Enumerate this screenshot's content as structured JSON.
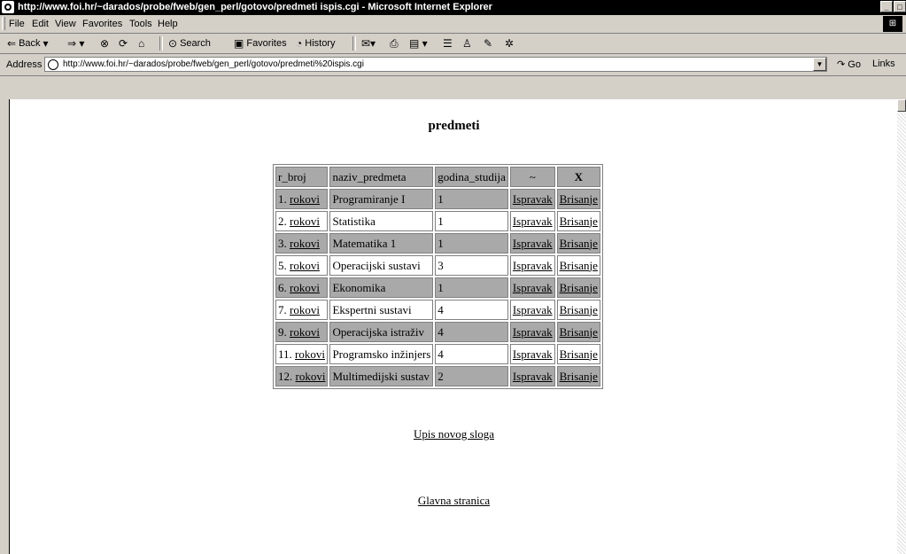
{
  "window": {
    "title": "http://www.foi.hr/~darados/probe/fweb/gen_perl/gotovo/predmeti ispis.cgi - Microsoft Internet Explorer"
  },
  "menu": [
    "File",
    "Edit",
    "View",
    "Favorites",
    "Tools",
    "Help"
  ],
  "toolbar": {
    "back": "Back",
    "search": "Search",
    "favorites": "Favorites",
    "history": "History"
  },
  "address": {
    "label": "Address",
    "url": "http://www.foi.hr/~darados/probe/fweb/gen_perl/gotovo/predmeti%20ispis.cgi",
    "go": "Go",
    "links": "Links"
  },
  "page": {
    "heading": "predmeti",
    "columns": [
      "r_broj",
      "naziv_predmeta",
      "godina_studija",
      "~",
      "X"
    ],
    "rows": [
      {
        "num": "1.",
        "link": "rokovi",
        "naziv": "Programiranje I",
        "godina": "1",
        "edit": "Ispravak",
        "delete": "Brisanje"
      },
      {
        "num": "2.",
        "link": "rokovi",
        "naziv": "Statistika",
        "godina": "1",
        "edit": "Ispravak",
        "delete": "Brisanje"
      },
      {
        "num": "3.",
        "link": "rokovi",
        "naziv": "Matematika 1",
        "godina": "1",
        "edit": "Ispravak",
        "delete": "Brisanje"
      },
      {
        "num": "5.",
        "link": "rokovi",
        "naziv": "Operacijski sustavi",
        "godina": "3",
        "edit": "Ispravak",
        "delete": "Brisanje"
      },
      {
        "num": "6.",
        "link": "rokovi",
        "naziv": "Ekonomika",
        "godina": "1",
        "edit": "Ispravak",
        "delete": "Brisanje"
      },
      {
        "num": "7.",
        "link": "rokovi",
        "naziv": "Ekspertni sustavi",
        "godina": "4",
        "edit": "Ispravak",
        "delete": "Brisanje"
      },
      {
        "num": "9.",
        "link": "rokovi",
        "naziv": "Operacijska istraživ",
        "godina": "4",
        "edit": "Ispravak",
        "delete": "Brisanje"
      },
      {
        "num": "11.",
        "link": "rokovi",
        "naziv": "Programsko inžinjers",
        "godina": "4",
        "edit": "Ispravak",
        "delete": "Brisanje"
      },
      {
        "num": "12.",
        "link": "rokovi",
        "naziv": "Multimedijski sustav",
        "godina": "2",
        "edit": "Ispravak",
        "delete": "Brisanje"
      }
    ],
    "new_record_link": "Upis novog sloga",
    "main_page_link": "Glavna stranica"
  },
  "colors": {
    "row_gray": "#a9a9a9",
    "row_white": "#ffffff",
    "titlebar": "#000000",
    "chrome": "#d4d0c8"
  }
}
